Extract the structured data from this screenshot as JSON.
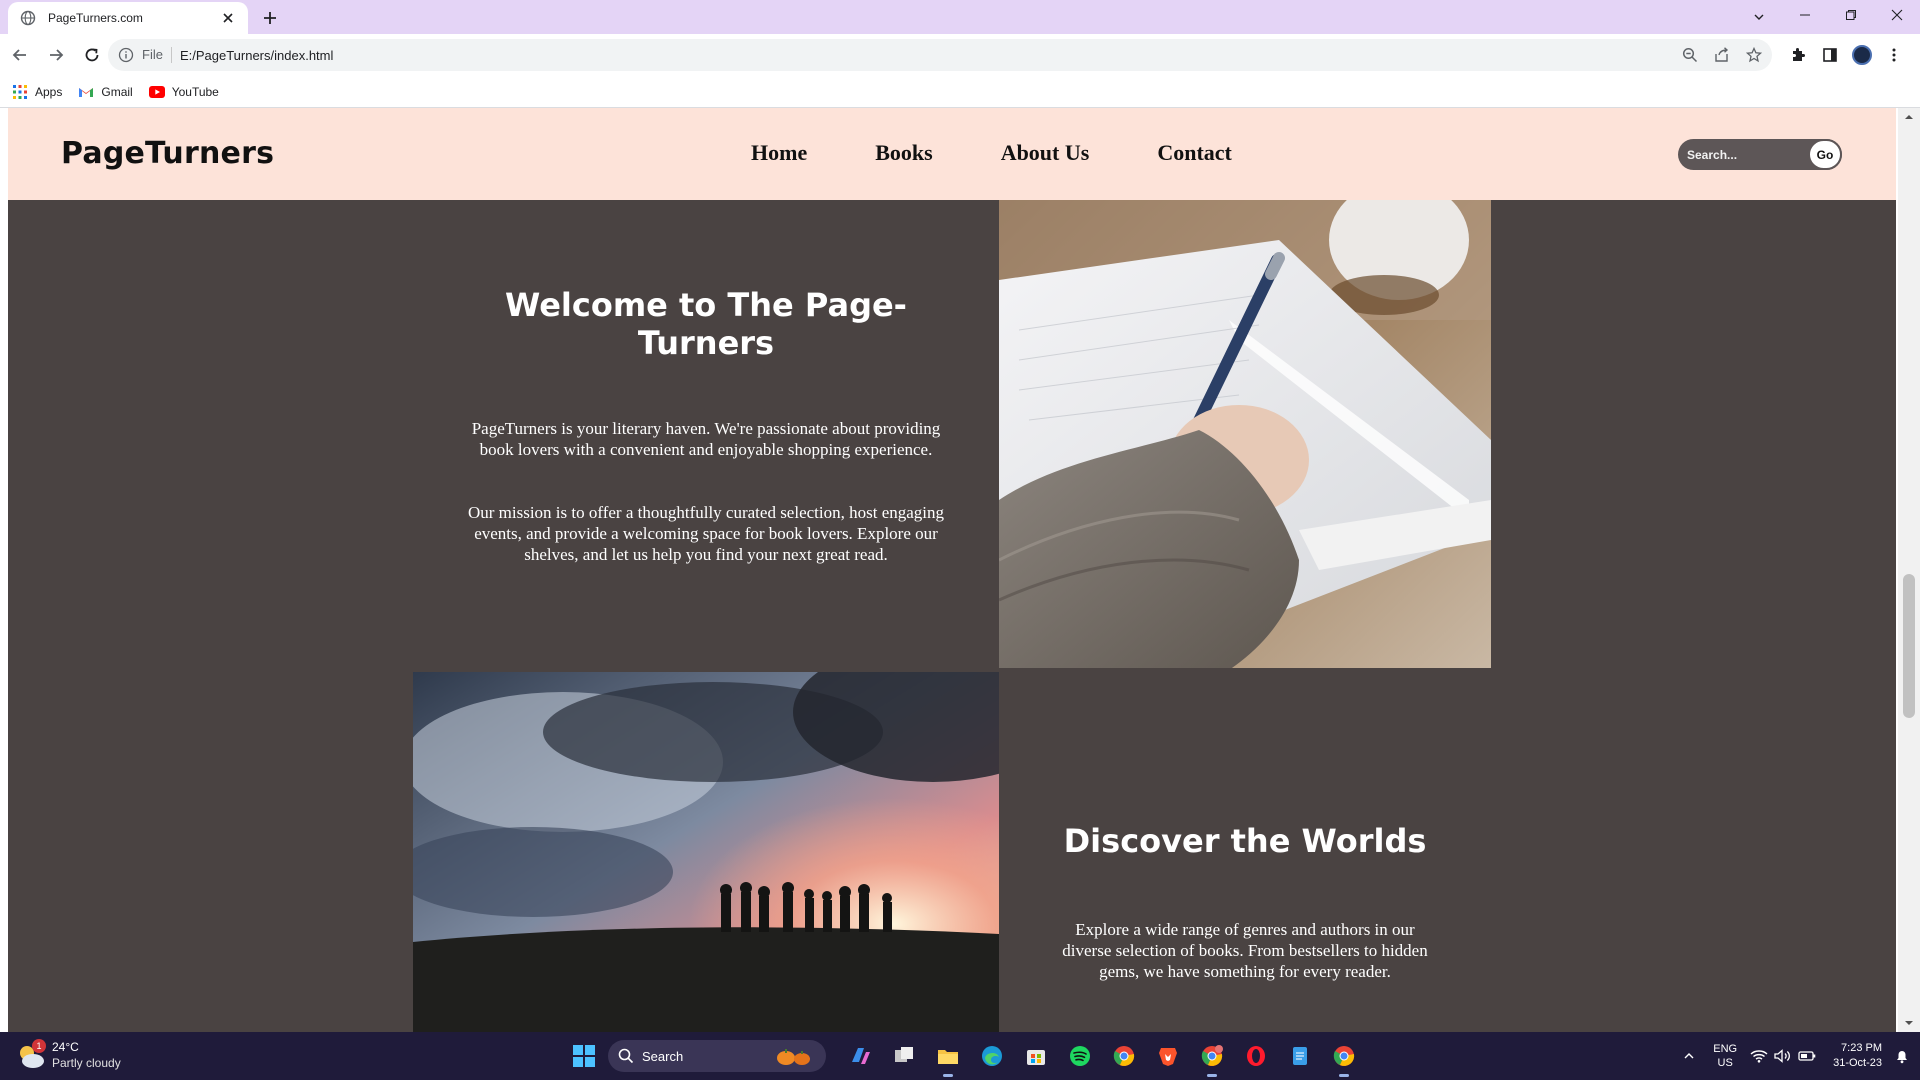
{
  "browser": {
    "tab_title": "PageTurners.com",
    "address_scheme": "File",
    "address_url": "E:/PageTurners/index.html",
    "bookmarks": [
      {
        "label": "Apps",
        "icon": "apps-grid-icon"
      },
      {
        "label": "Gmail",
        "icon": "gmail-icon"
      },
      {
        "label": "YouTube",
        "icon": "youtube-icon"
      }
    ]
  },
  "site": {
    "logo": "PageTurners",
    "nav": [
      "Home",
      "Books",
      "About Us",
      "Contact"
    ],
    "search_placeholder": "Search...",
    "search_button": "Go",
    "welcome": {
      "title": "Welcome to The Page-Turners",
      "p1": "PageTurners is your literary haven. We're passionate about providing book lovers with a convenient and enjoyable shopping experience.",
      "p2": "Our mission is to offer a thoughtfully curated selection, host engaging events, and provide a welcoming space for book lovers. Explore our shelves, and let us help you find your next great read."
    },
    "discover": {
      "title": "Discover the Worlds",
      "p": "Explore a wide range of genres and authors in our diverse selection of books. From bestsellers to hidden gems, we have something for every reader."
    },
    "colors": {
      "header_bg": "#fde3d9",
      "page_bg": "#4a4342",
      "search_bg": "#5d5657"
    }
  },
  "taskbar": {
    "weather_temp": "24°C",
    "weather_condition": "Partly cloudy",
    "weather_badge": "1",
    "search_label": "Search",
    "lang_top": "ENG",
    "lang_bottom": "US",
    "time": "7:23 PM",
    "date": "31-Oct-23"
  }
}
